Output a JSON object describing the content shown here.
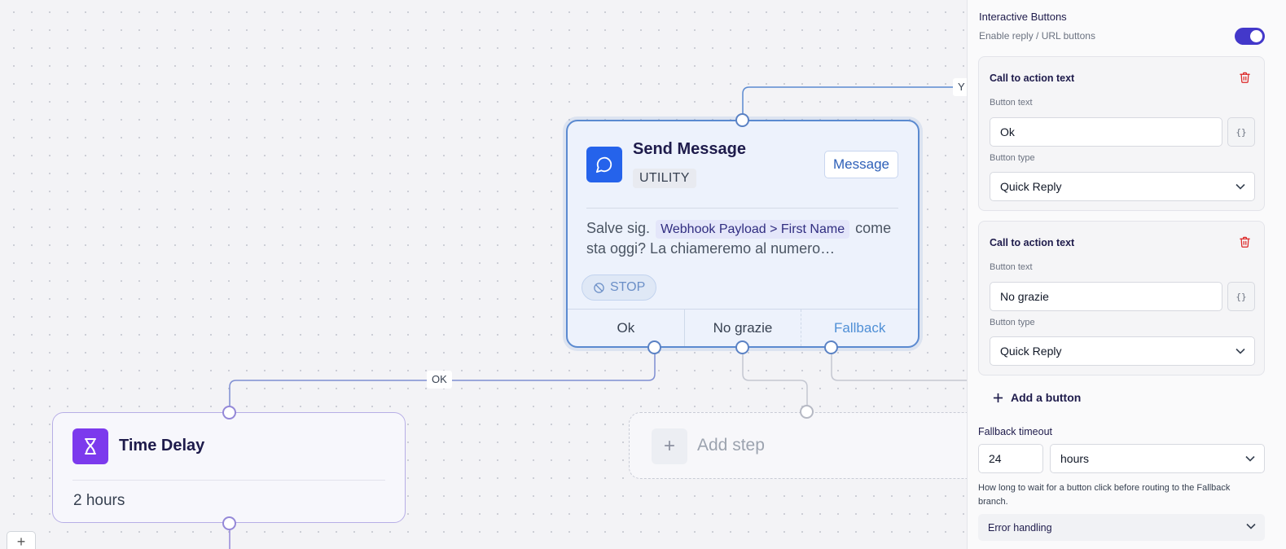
{
  "canvas": {
    "edges": {
      "ok_label": "OK",
      "top_label": "Y"
    },
    "send_message": {
      "title": "Send Message",
      "badge": "UTILITY",
      "action_label": "Message",
      "body_before": "Salve sig.",
      "body_variable": "Webhook Payload > First Name",
      "body_after": "come sta oggi? La chiameremo al numero…",
      "stop_label": "STOP",
      "buttons": [
        "Ok",
        "No grazie",
        "Fallback"
      ]
    },
    "time_delay": {
      "title": "Time Delay",
      "value": "2 hours"
    },
    "add_step": {
      "label": "Add step",
      "icon": "plus-icon"
    },
    "zoom_in": "+"
  },
  "panel": {
    "interactive_buttons": {
      "title": "Interactive Buttons",
      "subtitle": "Enable reply / URL buttons",
      "enabled": true
    },
    "cta_cards": [
      {
        "title": "Call to action text",
        "button_text_label": "Button text",
        "button_text_value": "Ok",
        "brace_label": "{}",
        "button_type_label": "Button type",
        "button_type_value": "Quick Reply"
      },
      {
        "title": "Call to action text",
        "button_text_label": "Button text",
        "button_text_value": "No grazie",
        "brace_label": "{}",
        "button_type_label": "Button type",
        "button_type_value": "Quick Reply"
      }
    ],
    "add_button_label": "Add a button",
    "fallback": {
      "label": "Fallback timeout",
      "value": "24",
      "unit": "hours",
      "help": "How long to wait for a button click before routing to the Fallback branch."
    },
    "error_handling_label": "Error handling"
  },
  "colors": {
    "accent_blue": "#2563eb",
    "accent_purple": "#7c3aed",
    "toggle_on": "#4338ca",
    "delete_red": "#dc2626"
  }
}
